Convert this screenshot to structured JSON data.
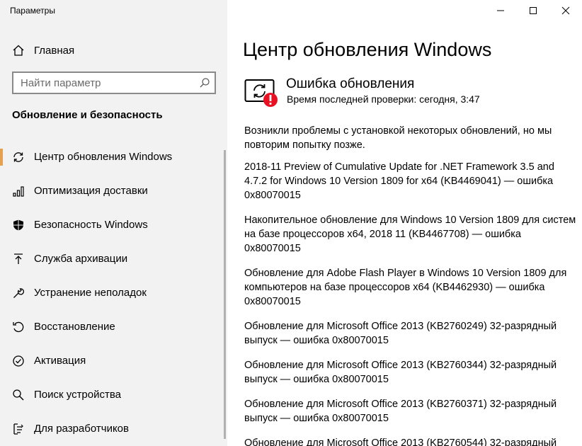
{
  "window": {
    "title": "Параметры"
  },
  "sidebar": {
    "home_label": "Главная",
    "search_placeholder": "Найти параметр",
    "section_title": "Обновление и безопасность",
    "items": [
      {
        "label": "Центр обновления Windows",
        "icon": "sync-icon",
        "selected": true
      },
      {
        "label": "Оптимизация доставки",
        "icon": "delivery-optimization-icon"
      },
      {
        "label": "Безопасность Windows",
        "icon": "shield-icon"
      },
      {
        "label": "Служба архивации",
        "icon": "backup-arrow-icon"
      },
      {
        "label": "Устранение неполадок",
        "icon": "wrench-icon"
      },
      {
        "label": "Восстановление",
        "icon": "recovery-icon"
      },
      {
        "label": "Активация",
        "icon": "check-circle-icon"
      },
      {
        "label": "Поиск устройства",
        "icon": "find-device-icon"
      },
      {
        "label": "Для разработчиков",
        "icon": "developer-icon"
      }
    ]
  },
  "main": {
    "title": "Центр обновления Windows",
    "status_heading": "Ошибка обновления",
    "status_sub": "Время последней проверки: сегодня, 3:47",
    "intro": "Возникли проблемы с установкой некоторых обновлений, но мы повторим попытку позже.",
    "updates": [
      "2018-11 Preview of Cumulative Update for .NET Framework 3.5 and 4.7.2 for Windows 10 Version 1809 for x64 (KB4469041) — ошибка 0x80070015",
      "Накопительное обновление для Windows 10 Version 1809 для систем на базе процессоров x64, 2018 11 (KB4467708) — ошибка 0x80070015",
      "Обновление для Adobe Flash Player в Windows 10 Version 1809 для компьютеров на базе процессоров x64 (KB4462930) — ошибка 0x80070015",
      "Обновление для Microsoft Office 2013 (KB2760249) 32-разрядный выпуск — ошибка 0x80070015",
      "Обновление для Microsoft Office 2013 (KB2760344) 32-разрядный выпуск — ошибка 0x80070015",
      "Обновление для Microsoft Office 2013 (KB2760371) 32-разрядный выпуск — ошибка 0x80070015",
      "Обновление для Microsoft Office 2013 (KB2760544) 32-разрядный"
    ]
  },
  "colors": {
    "sidebar_bg": "#f2f2f2",
    "accent": "#e5a050",
    "error": "#e81123"
  }
}
